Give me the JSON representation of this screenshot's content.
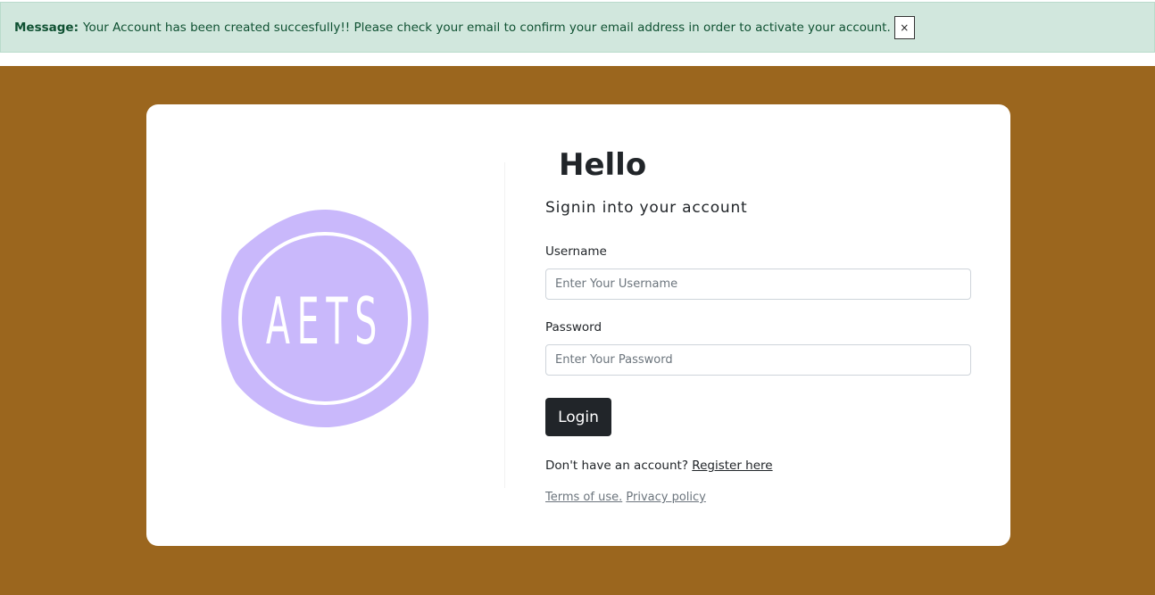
{
  "alert": {
    "label": "Message:",
    "text": "Your Account has been created succesfully!! Please check your email to confirm your email address in order to activate your account.",
    "close": "×"
  },
  "logo": {
    "text": "AETS",
    "badge_color": "#c9b8fb"
  },
  "login": {
    "heading": "Hello",
    "subtitle": "Signin into your account",
    "username_label": "Username",
    "username_placeholder": "Enter Your Username",
    "password_label": "Password",
    "password_placeholder": "Enter Your Password",
    "button": "Login",
    "no_account_text": "Don't have an account?",
    "register_link": "Register here",
    "terms_link": "Terms of use.",
    "privacy_link": "Privacy policy"
  },
  "colors": {
    "background": "#9b661e",
    "alert_bg": "#d1e7dd",
    "alert_text": "#0f5132",
    "button_bg": "#212529"
  }
}
